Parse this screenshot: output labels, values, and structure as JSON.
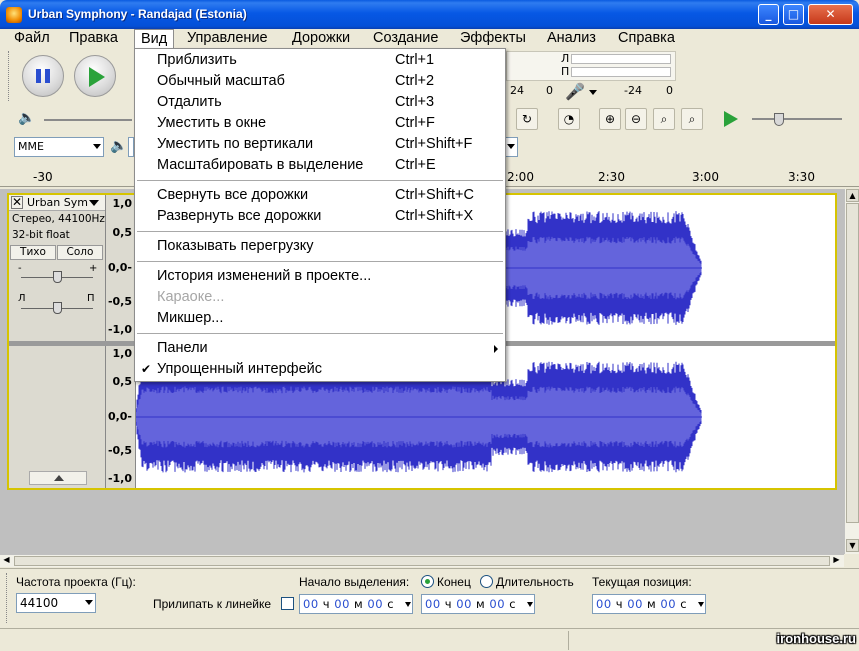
{
  "window": {
    "title": "Urban Symphony - Randajad (Estonia)"
  },
  "menubar": [
    "Файл",
    "Правка",
    "Вид",
    "Управление",
    "Дорожки",
    "Создание",
    "Эффекты",
    "Анализ",
    "Справка"
  ],
  "view_menu": {
    "items": [
      {
        "label": "Приблизить",
        "shortcut": "Ctrl+1"
      },
      {
        "label": "Обычный масштаб",
        "shortcut": "Ctrl+2"
      },
      {
        "label": "Отдалить",
        "shortcut": "Ctrl+3"
      },
      {
        "label": "Уместить в окне",
        "shortcut": "Ctrl+F"
      },
      {
        "label": "Уместить по вертикали",
        "shortcut": "Ctrl+Shift+F"
      },
      {
        "label": "Масштабировать в выделение",
        "shortcut": "Ctrl+E"
      },
      {
        "label": "Свернуть все дорожки",
        "shortcut": "Ctrl+Shift+C"
      },
      {
        "label": "Развернуть все дорожки",
        "shortcut": "Ctrl+Shift+X"
      },
      {
        "label": "Показывать перегрузку",
        "shortcut": ""
      },
      {
        "label": "История изменений в проекте...",
        "shortcut": ""
      },
      {
        "label": "Караоке...",
        "shortcut": "",
        "disabled": true
      },
      {
        "label": "Микшер...",
        "shortcut": ""
      },
      {
        "label": "Панели",
        "shortcut": "",
        "submenu": true
      },
      {
        "label": "Упрощенный интерфейс",
        "shortcut": "",
        "checked": true
      }
    ]
  },
  "toolbar": {
    "audio_host": "MME",
    "meter_labels": {
      "l": "Л",
      "r": "П",
      "db_left": "24",
      "db_mid": "0",
      "db_right": "-24",
      "db_zero": "0"
    }
  },
  "ruler": {
    "ticks": [
      "-30",
      "2:00",
      "2:30",
      "3:00",
      "3:30"
    ]
  },
  "track": {
    "name": "Urban Sym",
    "format": "Стерео, 44100Hz",
    "bitdepth": "32-bit float",
    "mute": "Тихо",
    "solo": "Соло",
    "pan_l": "Л",
    "pan_r": "П",
    "gain_minus": "-",
    "gain_plus": "+",
    "scale": [
      "1,0",
      "0,5",
      "0,0-",
      "-0,5",
      "-1,0"
    ]
  },
  "selection_bar": {
    "rate_label": "Частота проекта (Гц):",
    "rate_value": "44100",
    "snap_label": "Прилипать к линейке",
    "start_label": "Начало выделения:",
    "end_label": "Конец",
    "length_label": "Длительность",
    "position_label": "Текущая позиция:",
    "time_h": "00",
    "time_h_unit": "ч",
    "time_m": "00",
    "time_m_unit": "м",
    "time_s": "00",
    "time_s_unit": "с"
  },
  "watermark": "ironhouse.ru",
  "colors": {
    "waveform": "#3232c8",
    "waveform_rms": "#6464dc",
    "selection_border": "#d6c400",
    "titlebar": "#0a5be0"
  }
}
